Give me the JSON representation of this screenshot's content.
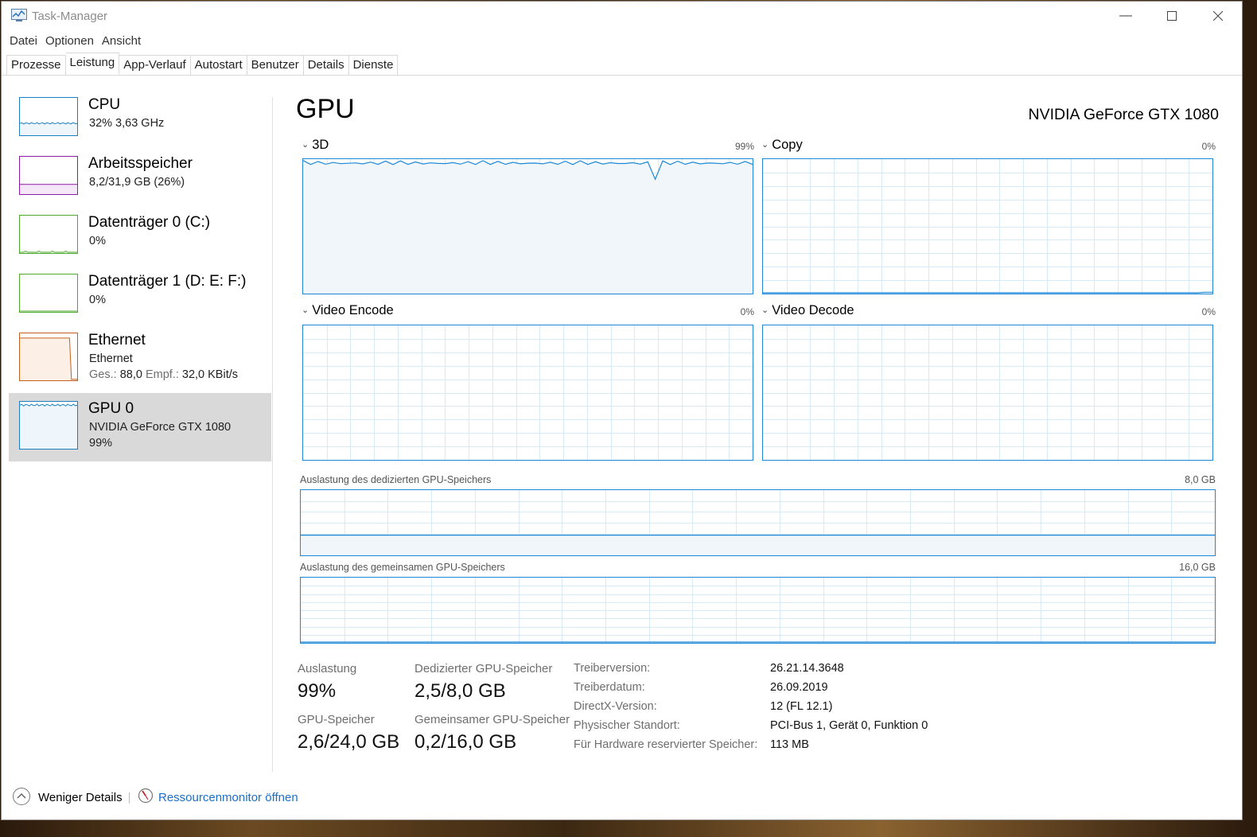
{
  "window": {
    "title": "Task-Manager"
  },
  "menu": [
    "Datei",
    "Optionen",
    "Ansicht"
  ],
  "tabs": [
    "Prozesse",
    "Leistung",
    "App-Verlauf",
    "Autostart",
    "Benutzer",
    "Details",
    "Dienste"
  ],
  "active_tab": "Leistung",
  "sidebar": [
    {
      "title": "CPU",
      "sub": "32%  3,63 GHz",
      "color": "#1c7fc4",
      "level": 0.32
    },
    {
      "title": "Arbeitsspeicher",
      "sub": "8,2/31,9 GB (26%)",
      "color": "#8b1aa6",
      "level": 0.26
    },
    {
      "title": "Datenträger 0 (C:)",
      "sub": "0%",
      "color": "#4ca92e",
      "level": 0.0
    },
    {
      "title": "Datenträger 1 (D: E: F:)",
      "sub": "0%",
      "color": "#4ca92e",
      "level": 0.0
    },
    {
      "title": "Ethernet",
      "sub": "Ethernet",
      "sub2_label1": "Ges.:",
      "sub2_val1": "88,0",
      "sub2_label2": "Empf.:",
      "sub2_val2": "32,0 KBit/s",
      "color": "#c2611e"
    },
    {
      "title": "GPU 0",
      "sub": "NVIDIA GeForce GTX 1080",
      "sub2": "99%",
      "color": "#1c7fc4",
      "level": 0.99
    }
  ],
  "gpu": {
    "heading": "GPU",
    "model": "NVIDIA GeForce GTX 1080",
    "engines": [
      {
        "name": "3D",
        "pct": "99%",
        "level": 0.99
      },
      {
        "name": "Copy",
        "pct": "0%",
        "level": 0.0
      },
      {
        "name": "Video Encode",
        "pct": "0%",
        "level": 0.0
      },
      {
        "name": "Video Decode",
        "pct": "0%",
        "level": 0.0
      }
    ],
    "dedicated_mem_label": "Auslastung des dedizierten GPU-Speichers",
    "dedicated_mem_max": "8,0 GB",
    "dedicated_mem_level": 0.31,
    "shared_mem_label": "Auslastung des gemeinsamen GPU-Speichers",
    "shared_mem_max": "16,0 GB",
    "shared_mem_level": 0.0125
  },
  "stats": {
    "utilization_label": "Auslastung",
    "utilization_value": "99%",
    "dedicated_label": "Dedizierter GPU-Speicher",
    "dedicated_value": "2,5/8,0 GB",
    "gpu_mem_label": "GPU-Speicher",
    "gpu_mem_value": "2,6/24,0 GB",
    "shared_label": "Gemeinsamer GPU-Speicher",
    "shared_value": "0,2/16,0 GB"
  },
  "info": [
    {
      "key": "Treiberversion:",
      "value": "26.21.14.3648"
    },
    {
      "key": "Treiberdatum:",
      "value": "26.09.2019"
    },
    {
      "key": "DirectX-Version:",
      "value": "12 (FL 12.1)"
    },
    {
      "key": "Physischer Standort:",
      "value": "PCI-Bus 1, Gerät 0, Funktion 0"
    },
    {
      "key": "Für Hardware reservierter Speicher:",
      "value": "113 MB"
    }
  ],
  "footer": {
    "fewer_details": "Weniger Details",
    "resource_monitor": "Ressourcenmonitor öffnen"
  },
  "accent": "#1e88d6"
}
